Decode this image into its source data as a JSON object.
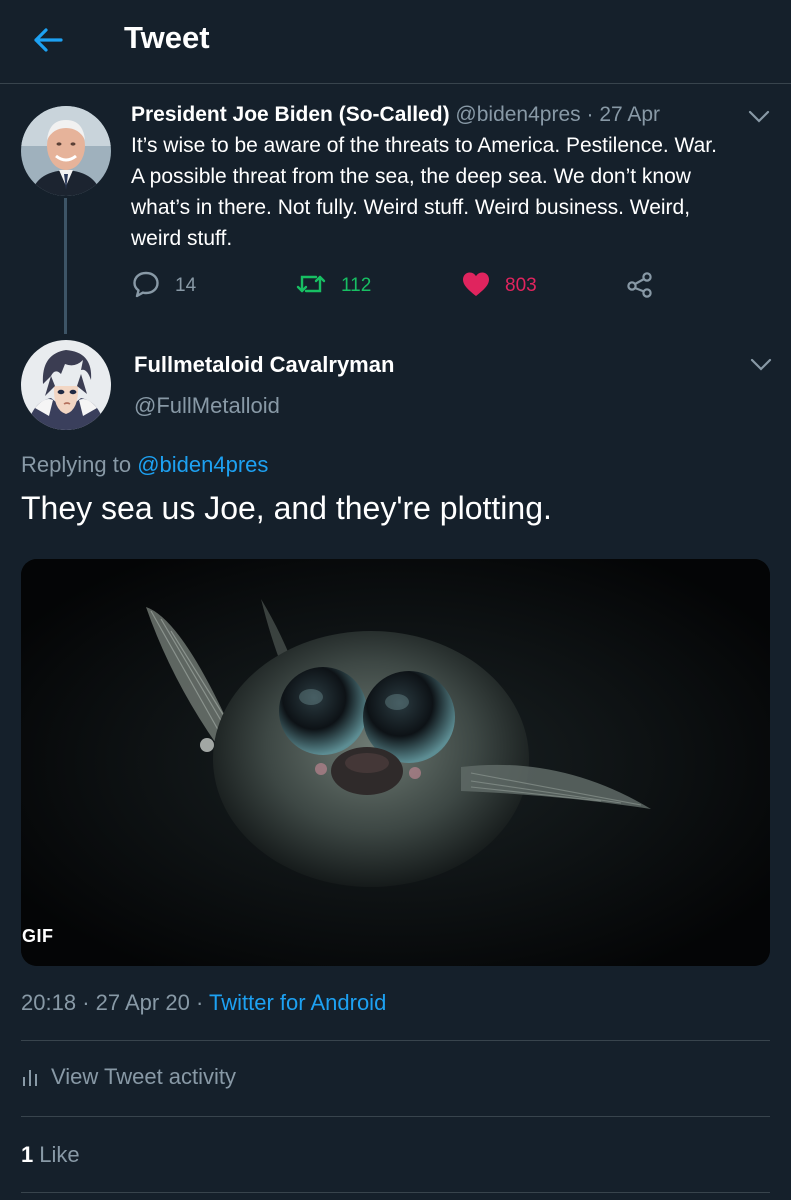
{
  "header": {
    "title": "Tweet"
  },
  "parent_tweet": {
    "name": "President Joe Biden (So-Called)",
    "handle": "@biden4pres",
    "separator": "·",
    "date": "27 Apr",
    "text_lines": [
      "It’s wise to be aware of the threats to America. Pestilence. War.",
      "A possible threat from the sea, the deep sea. We don’t know",
      "what’s in there. Not fully. Weird stuff. Weird business. Weird,",
      "weird stuff."
    ],
    "replies": "14",
    "retweets": "112",
    "likes": "803"
  },
  "reply_tweet": {
    "name": "Fullmetaloid Cavalryman",
    "handle": "@FullMetalloid",
    "replying_label": "Replying to",
    "replying_to": "@biden4pres",
    "text": "They sea us Joe, and they're plotting.",
    "media_badge": "GIF",
    "time": "20:18",
    "date": "27 Apr 20",
    "separator": "·",
    "source": "Twitter for Android",
    "activity_label": "View Tweet activity",
    "like_count": "1",
    "like_label": "Like"
  },
  "icons": {
    "back": "arrow-left-icon",
    "caret": "chevron-down-icon",
    "reply": "comment-icon",
    "retweet": "retweet-icon",
    "like": "heart-icon",
    "share": "share-icon",
    "activity": "bar-chart-icon"
  },
  "colors": {
    "background": "#15202b",
    "accent": "#1da1f2",
    "muted": "#8899a6",
    "retweet": "#17bf63",
    "like": "#e0245e",
    "divider": "#38444d"
  }
}
